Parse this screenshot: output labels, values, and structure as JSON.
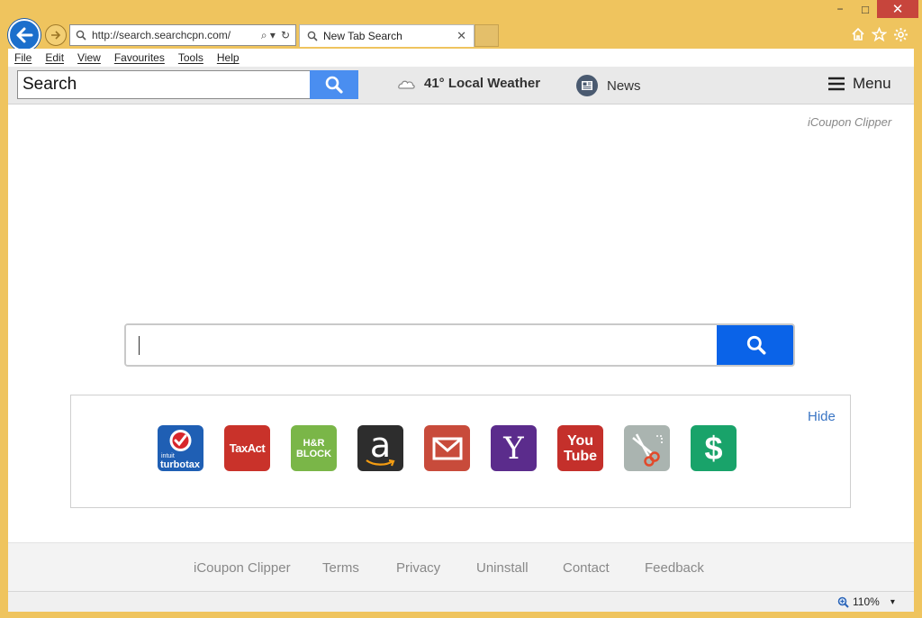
{
  "window": {
    "minimize": "−",
    "maximize": "□",
    "close": "✕"
  },
  "address_bar": {
    "url": "http://search.searchcpn.com/",
    "search_symbol": "⌕ ▾",
    "refresh_symbol": "↻"
  },
  "tab": {
    "title": "New Tab Search",
    "close": "✕"
  },
  "menu_bar": [
    "File",
    "Edit",
    "View",
    "Favourites",
    "Tools",
    "Help"
  ],
  "toolbar": {
    "search_text": "Search",
    "weather": "41° Local Weather",
    "news": "News",
    "menu": "Menu"
  },
  "brand": "iCoupon Clipper",
  "main_search": {
    "value": ""
  },
  "shortcuts": {
    "hide_label": "Hide",
    "tiles": [
      {
        "name": "turbotax",
        "caption": "turbotax",
        "small": "intuit",
        "color": "#1f5fb4"
      },
      {
        "name": "taxact",
        "caption": "TaxAct",
        "color": "#c9322a"
      },
      {
        "name": "hrblock",
        "caption": "H&R BLOCK",
        "color": "#7ab648"
      },
      {
        "name": "amazon",
        "caption": "a",
        "color": "#2d2d2d"
      },
      {
        "name": "gmail",
        "caption": "",
        "color": "#c84b3b"
      },
      {
        "name": "yahoo",
        "caption": "Y",
        "color": "#5b2c8c"
      },
      {
        "name": "youtube",
        "caption": "You Tube",
        "color": "#c4302b"
      },
      {
        "name": "coupon-clipper",
        "caption": "",
        "color": "#aab4b0"
      },
      {
        "name": "money",
        "caption": "$",
        "color": "#19a36a"
      }
    ]
  },
  "footer": [
    "iCoupon Clipper",
    "Terms",
    "Privacy",
    "Uninstall",
    "Contact",
    "Feedback"
  ],
  "status_bar": {
    "zoom": "110%",
    "zoom_arrow": "▾"
  }
}
